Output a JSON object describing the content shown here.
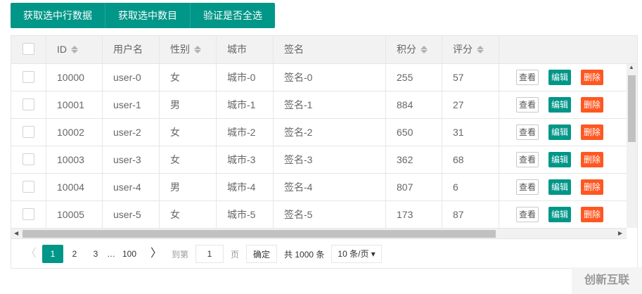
{
  "toolbar": {
    "get_row_data": "获取选中行数据",
    "get_count": "获取选中数目",
    "check_all": "验证是否全选"
  },
  "columns": [
    {
      "label": "ID",
      "sort": true
    },
    {
      "label": "用户名",
      "sort": false
    },
    {
      "label": "性别",
      "sort": true
    },
    {
      "label": "城市",
      "sort": false
    },
    {
      "label": "签名",
      "sort": false
    },
    {
      "label": "积分",
      "sort": true
    },
    {
      "label": "评分",
      "sort": true
    }
  ],
  "rows": [
    [
      "10000",
      "user-0",
      "女",
      "城市-0",
      "签名-0",
      "255",
      "57"
    ],
    [
      "10001",
      "user-1",
      "男",
      "城市-1",
      "签名-1",
      "884",
      "27"
    ],
    [
      "10002",
      "user-2",
      "女",
      "城市-2",
      "签名-2",
      "650",
      "31"
    ],
    [
      "10003",
      "user-3",
      "女",
      "城市-3",
      "签名-3",
      "362",
      "68"
    ],
    [
      "10004",
      "user-4",
      "男",
      "城市-4",
      "签名-4",
      "807",
      "6"
    ],
    [
      "10005",
      "user-5",
      "女",
      "城市-5",
      "签名-5",
      "173",
      "87"
    ]
  ],
  "actions": {
    "view": "查看",
    "edit": "编辑",
    "delete": "删除"
  },
  "pager": {
    "prev": "〈",
    "pages": [
      "1",
      "2",
      "3"
    ],
    "ellipsis": "…",
    "last": "100",
    "next": "〉",
    "goto": "到第",
    "page_value": "1",
    "page_unit": "页",
    "confirm": "确定",
    "total": "共 1000 条",
    "limit": "10 条/页 ▾"
  },
  "logo": "创新互联"
}
